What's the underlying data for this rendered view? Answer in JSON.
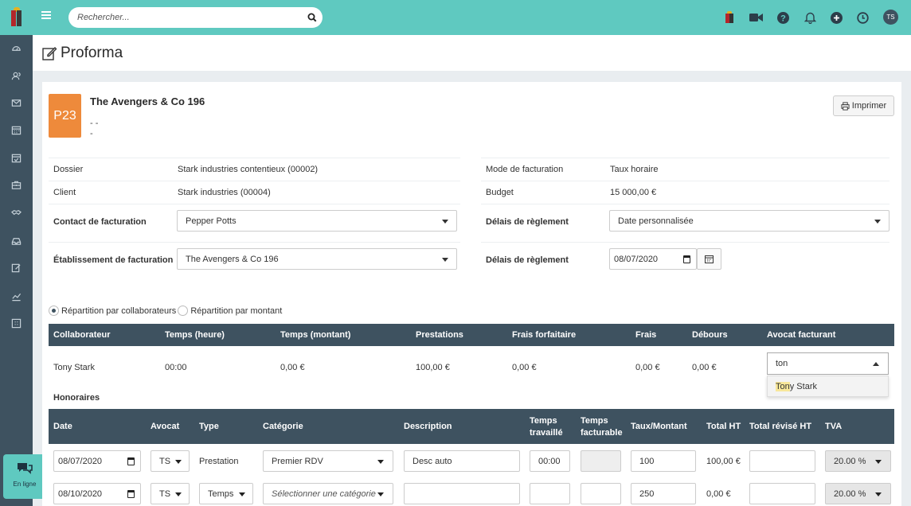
{
  "colors": {
    "teal": "#5fc9c0",
    "dark": "#3e5260",
    "badge": "#ee8a3b",
    "highlight": "#f8e79a"
  },
  "search": {
    "placeholder": "Rechercher..."
  },
  "topbar": {
    "avatar_initials": "TS",
    "icons": [
      "logo-icon",
      "video-icon",
      "help-icon",
      "bell-icon",
      "plus-icon",
      "clock-icon"
    ]
  },
  "sidebar": {
    "icons": [
      "dashboard-icon",
      "contacts-icon",
      "mail-icon",
      "calendar-icon",
      "calendar-check-icon",
      "briefcase-icon",
      "handshake-icon",
      "tray-icon",
      "edit-icon",
      "chart-icon",
      "grid-icon"
    ],
    "online_label": "En ligne"
  },
  "page": {
    "title": "Proforma"
  },
  "client": {
    "badge": "P23",
    "name": "The Avengers & Co 196",
    "line1": "- -",
    "line2": "-",
    "print_label": "Imprimer"
  },
  "fields": {
    "dossier_label": "Dossier",
    "dossier_value": "Stark industries contentieux (00002)",
    "client_label": "Client",
    "client_value": "Stark industries (00004)",
    "contact_label": "Contact de facturation",
    "contact_value": "Pepper Potts",
    "etab_label": "Établissement de facturation",
    "etab_value": "The Avengers & Co 196",
    "mode_label": "Mode de facturation",
    "mode_value": "Taux horaire",
    "budget_label": "Budget",
    "budget_value": "15 000,00 €",
    "delais1_label": "Délais de règlement",
    "delais1_value": "Date personnalisée",
    "delais2_label": "Délais de règlement",
    "delais2_value": "08/07/2020"
  },
  "repartition": {
    "opt1": "Répartition par collaborateurs",
    "opt2": "Répartition par montant"
  },
  "collab_table": {
    "headers": [
      "Collaborateur",
      "Temps (heure)",
      "Temps (montant)",
      "Prestations",
      "Frais forfaitaire",
      "Frais",
      "Débours",
      "Avocat facturant"
    ],
    "row": [
      "Tony Stark",
      "00:00",
      "0,00 €",
      "100,00 €",
      "0,00 €",
      "0,00 €",
      "0,00 €"
    ],
    "combo_value": "ton",
    "suggestion_match": "Ton",
    "suggestion_rest": "y Stark"
  },
  "honoraires": {
    "title": "Honoraires",
    "headers": [
      "Date",
      "Avocat",
      "Type",
      "Catégorie",
      "Description",
      "Temps",
      "travaillé",
      "Temps",
      "facturable",
      "Taux/Montant",
      "Total HT",
      "Total révisé HT",
      "TVA"
    ],
    "rows": [
      {
        "date": "08/07/2020",
        "avocat": "TS",
        "type": "Prestation",
        "categorie": "Premier RDV",
        "description": "Desc auto",
        "temps": "00:00",
        "taux": "100",
        "total": "100,00 €",
        "tva": "20.00 %"
      },
      {
        "date": "08/10/2020",
        "avocat": "TS",
        "type": "Temps",
        "categorie": "Sélectionner une catégorie",
        "description": "",
        "temps": "",
        "taux": "250",
        "total": "0,00 €",
        "tva": "20.00 %"
      }
    ]
  }
}
